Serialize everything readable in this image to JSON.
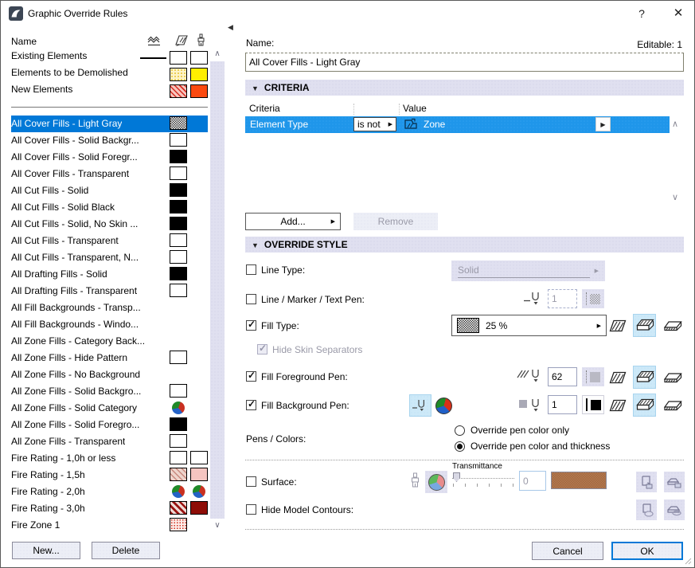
{
  "window": {
    "title": "Graphic Override Rules",
    "help": "?",
    "close": "✕"
  },
  "colors": {
    "accent": "#0078d7",
    "criteria_selection": "#1f96ea",
    "section_header_bg": "#e0e0f0",
    "surface_swatch": "#ab6f4c"
  },
  "sidebar": {
    "name_header": "Name",
    "header_icons": [
      "linetype-icon",
      "fill-icon",
      "surface-icon"
    ],
    "predefined": [
      {
        "label": "Existing Elements",
        "swatches": [
          "line",
          "white",
          "white"
        ]
      },
      {
        "label": "Elements to be Demolished",
        "swatches": [
          "yellowdots",
          "yellow"
        ]
      },
      {
        "label": "New Elements",
        "swatches": [
          "redhatch",
          "orange"
        ]
      }
    ],
    "rules": [
      {
        "label": "All Cover Fills - Light Gray",
        "swatches": [
          "checker"
        ],
        "selected": true
      },
      {
        "label": "All Cover Fills - Solid Backgr...",
        "swatches": [
          "white"
        ],
        "selected": false
      },
      {
        "label": "All Cover Fills - Solid Foregr...",
        "swatches": [
          "black"
        ],
        "selected": false
      },
      {
        "label": "All Cover Fills - Transparent",
        "swatches": [
          "white"
        ],
        "selected": false
      },
      {
        "label": "All Cut Fills - Solid",
        "swatches": [
          "black"
        ],
        "selected": false
      },
      {
        "label": "All Cut Fills - Solid Black",
        "swatches": [
          "black"
        ],
        "selected": false
      },
      {
        "label": "All Cut Fills - Solid, No Skin ...",
        "swatches": [
          "black"
        ],
        "selected": false
      },
      {
        "label": "All Cut Fills - Transparent",
        "swatches": [
          "white"
        ],
        "selected": false
      },
      {
        "label": "All Cut Fills - Transparent, N...",
        "swatches": [
          "white"
        ],
        "selected": false
      },
      {
        "label": "All Drafting Fills - Solid",
        "swatches": [
          "black"
        ],
        "selected": false
      },
      {
        "label": "All Drafting Fills - Transparent",
        "swatches": [
          "white"
        ],
        "selected": false
      },
      {
        "label": "All Fill Backgrounds - Transp...",
        "swatches": [],
        "selected": false
      },
      {
        "label": "All Fill Backgrounds - Windo...",
        "swatches": [],
        "selected": false
      },
      {
        "label": "All Zone Fills - Category Back...",
        "swatches": [],
        "selected": false
      },
      {
        "label": "All Zone Fills - Hide Pattern",
        "swatches": [
          "white"
        ],
        "selected": false
      },
      {
        "label": "All Zone Fills - No Background",
        "swatches": [],
        "selected": false
      },
      {
        "label": "All Zone Fills - Solid Backgro...",
        "swatches": [
          "white"
        ],
        "selected": false
      },
      {
        "label": "All Zone Fills - Solid Category",
        "swatches": [
          "pie"
        ],
        "selected": false
      },
      {
        "label": "All Zone Fills - Solid Foregro...",
        "swatches": [
          "black"
        ],
        "selected": false
      },
      {
        "label": "All Zone Fills - Transparent",
        "swatches": [
          "white"
        ],
        "selected": false
      },
      {
        "label": "Fire Rating - 1,0h or less",
        "swatches": [
          "white",
          "white"
        ],
        "selected": false
      },
      {
        "label": "Fire Rating - 1,5h",
        "swatches": [
          "pinkhatch",
          "pink"
        ],
        "selected": false
      },
      {
        "label": "Fire Rating - 2,0h",
        "swatches": [
          "pie",
          "pie"
        ],
        "selected": false
      },
      {
        "label": "Fire Rating - 3,0h",
        "swatches": [
          "dredhatch",
          "dred"
        ],
        "selected": false
      },
      {
        "label": "Fire Zone 1",
        "swatches": [
          "reddots"
        ],
        "selected": false
      }
    ],
    "new_button": "New...",
    "delete_button": "Delete"
  },
  "main": {
    "name_label": "Name:",
    "editable": "Editable: 1",
    "name_value": "All Cover Fills - Light Gray",
    "criteria": {
      "header": "CRITERIA",
      "col_criteria": "Criteria",
      "col_value": "Value",
      "row": {
        "criteria": "Element Type",
        "operator": "is not",
        "value": "Zone"
      },
      "add_button": "Add...",
      "remove_button": "Remove"
    },
    "override": {
      "header": "OVERRIDE STYLE",
      "line_type": {
        "label": "Line Type:",
        "checked": false,
        "value": "Solid"
      },
      "line_pen": {
        "label": "Line / Marker / Text Pen:",
        "checked": false,
        "value": "1"
      },
      "fill_type": {
        "label": "Fill Type:",
        "checked": true,
        "value": "25 %"
      },
      "hide_skin": {
        "label": "Hide Skin Separators",
        "checked": true
      },
      "fg_pen": {
        "label": "Fill Foreground Pen:",
        "checked": true,
        "value": "62"
      },
      "bg_pen": {
        "label": "Fill Background Pen:",
        "checked": true,
        "value": "1"
      },
      "pens_colors": {
        "label": "Pens / Colors:",
        "options": [
          "Override pen color only",
          "Override pen color and thickness"
        ],
        "selected_index": 1
      },
      "surface": {
        "label": "Surface:",
        "checked": false,
        "transmittance_label": "Transmittance",
        "transmittance_value": "0"
      },
      "hide_contours": {
        "label": "Hide Model Contours:",
        "checked": false
      }
    },
    "cancel_button": "Cancel",
    "ok_button": "OK"
  }
}
